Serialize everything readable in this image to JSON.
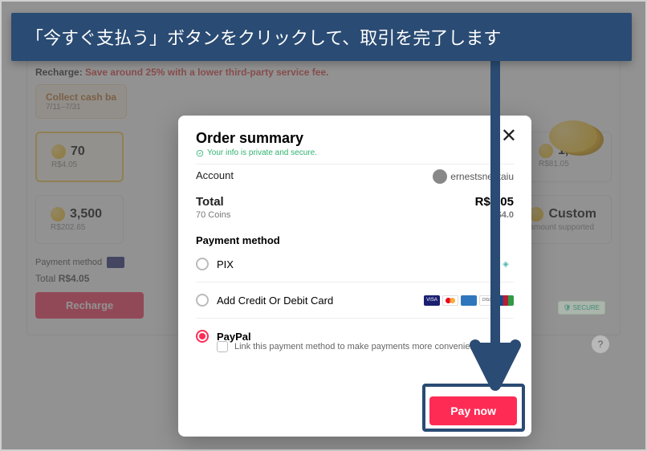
{
  "callout": "「今すぐ支払う」ボタンをクリックして、取引を完了します",
  "background": {
    "recharge_label": "Recharge:",
    "recharge_save": "Save around 25% with a lower third-party service fee.",
    "cashback_title": "Collect cash ba",
    "cashback_dates": "7/11–7/31",
    "coin_options": [
      {
        "amount": "70",
        "price": "R$4.05",
        "selected": true
      },
      {
        "amount": "1,400",
        "price": "R$81.05",
        "selected": false
      },
      {
        "amount": "3,500",
        "price": "R$202.65",
        "selected": false
      },
      {
        "amount": "Custom",
        "price": "amount supported",
        "selected": false
      }
    ],
    "pm_label": "Payment method",
    "total_label": "Total",
    "total_value": "R$4.05",
    "recharge_btn": "Recharge",
    "help_label": "?",
    "secure_badge": "SECURE"
  },
  "modal": {
    "title": "Order summary",
    "secure_msg": "Your info is private and secure.",
    "close": "✕",
    "account_label": "Account",
    "account_value": "ernestsneptaiu",
    "total_label": "Total",
    "total_value": "R$4.05",
    "coins_label": "70 Coins",
    "coins_price": "R$4.0",
    "pm_label": "Payment method",
    "options": {
      "pix": "PIX",
      "card": "Add Credit Or Debit Card",
      "paypal": "PayPal",
      "paypal_link": "Link this payment method to make payments more convenient"
    },
    "pay_btn": "Pay now"
  }
}
